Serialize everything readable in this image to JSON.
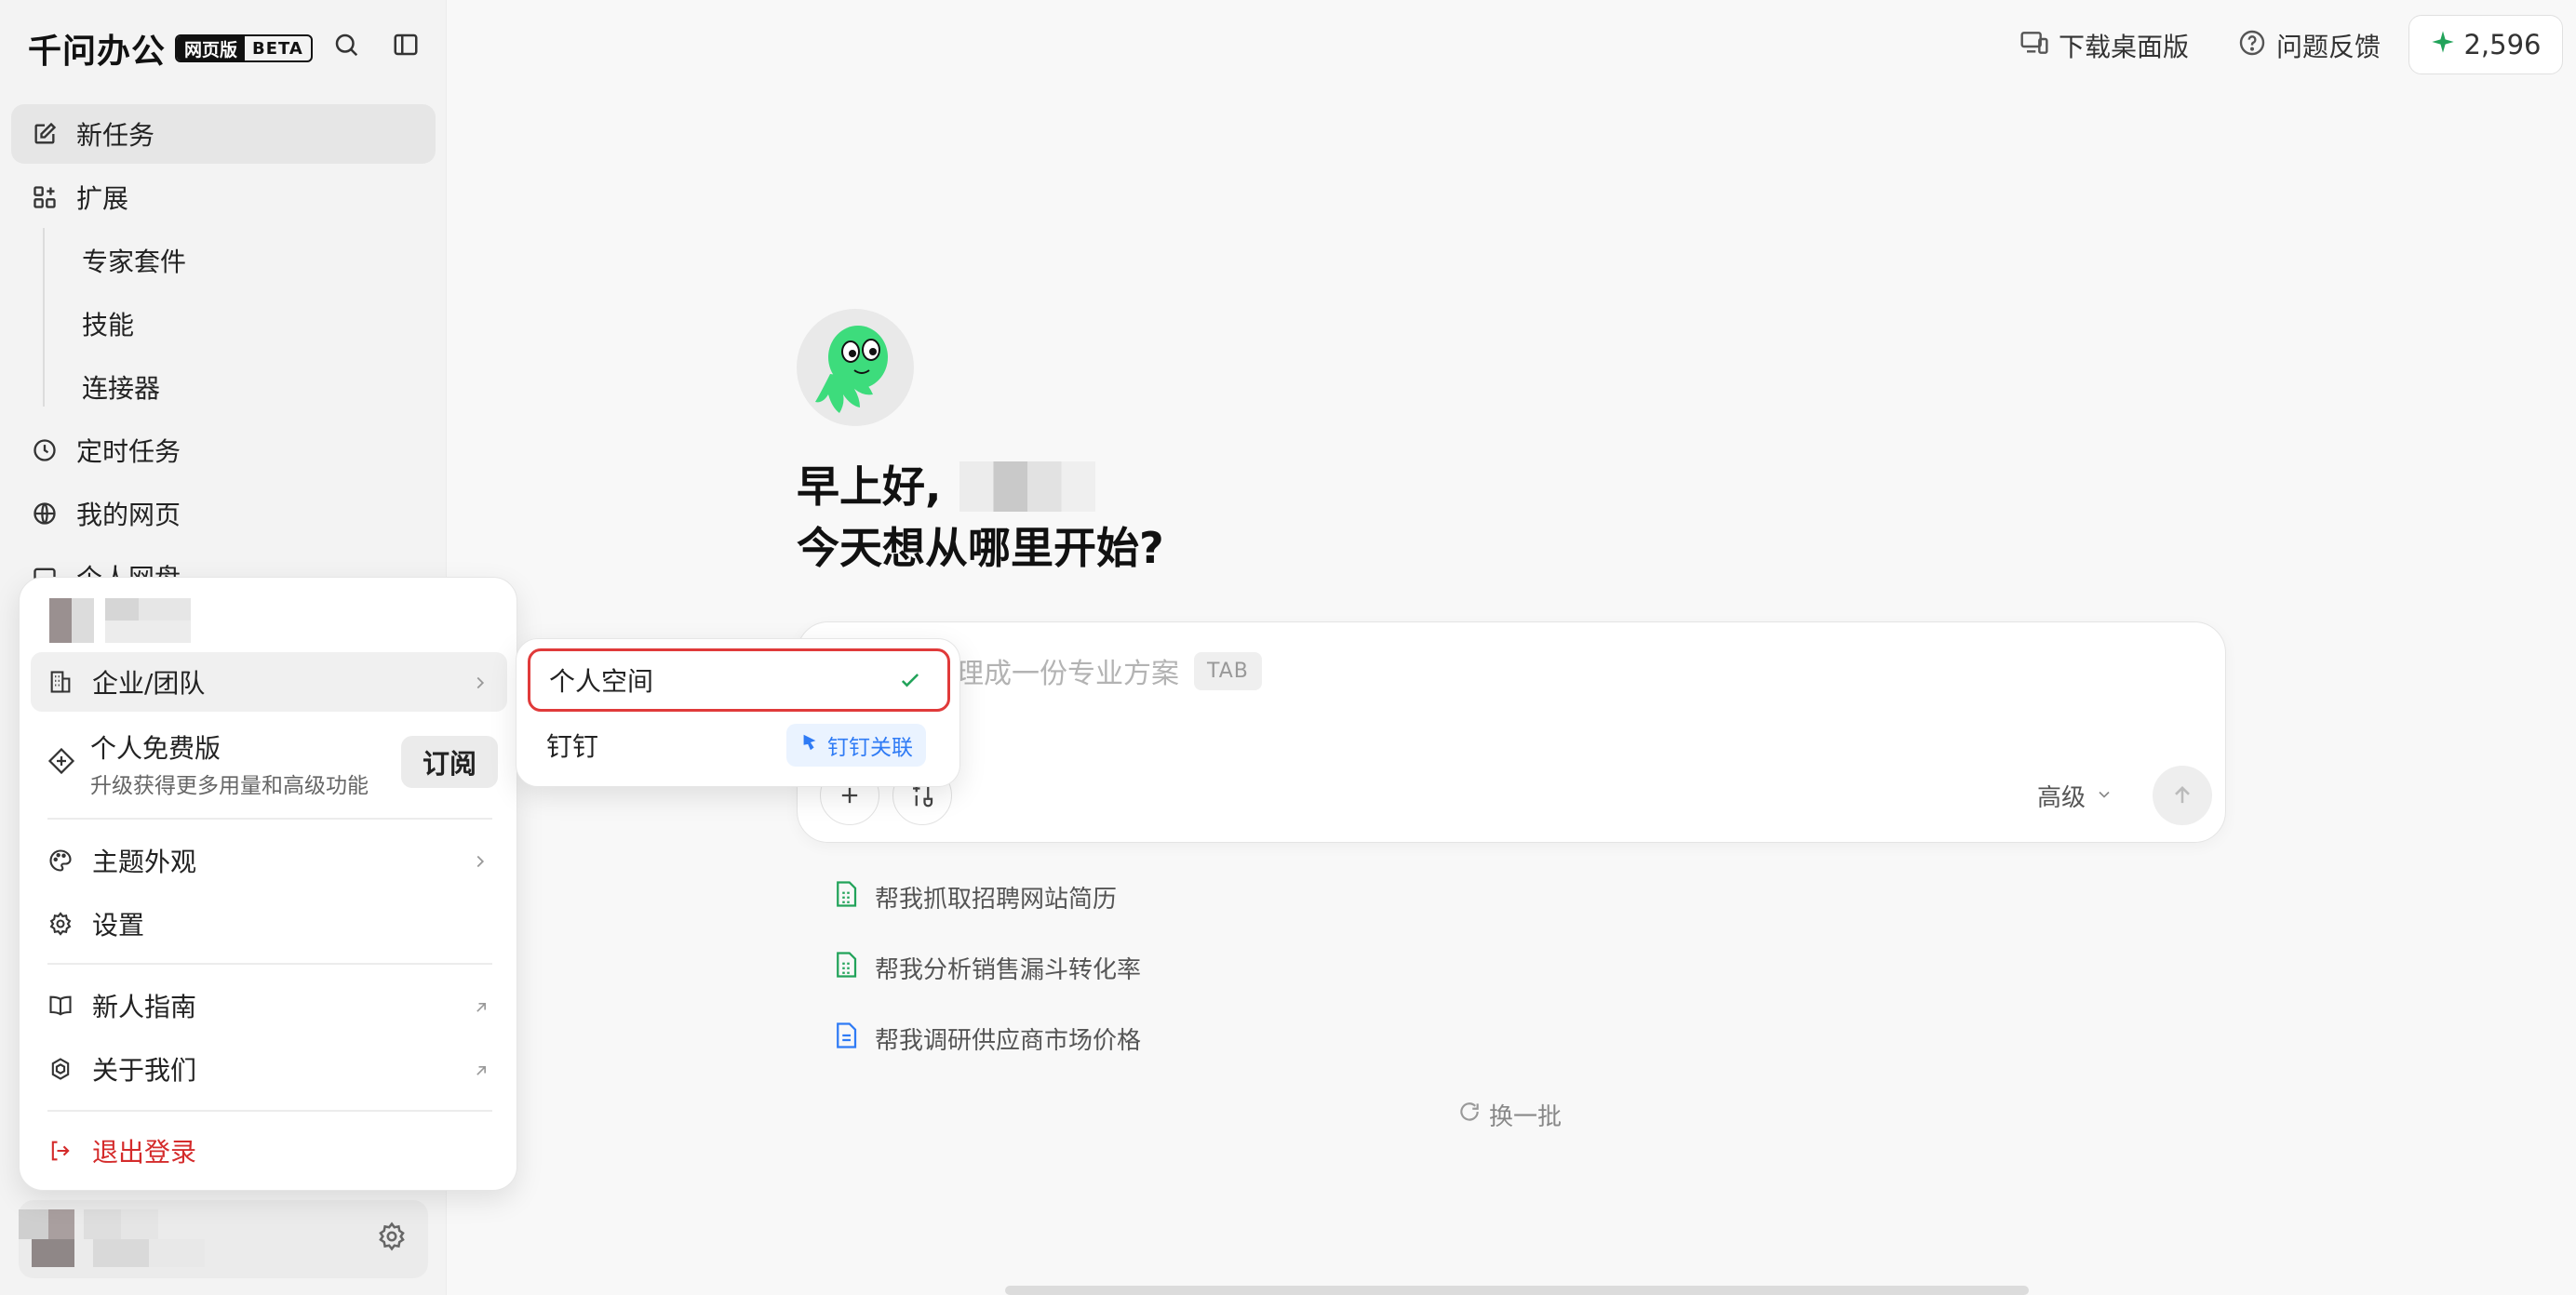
{
  "brand": {
    "name": "千问办公",
    "tag1": "网页版",
    "tag2": "BETA"
  },
  "sidebar": {
    "new_task": "新任务",
    "extensions": "扩展",
    "sub_items": [
      "专家套件",
      "技能",
      "连接器"
    ],
    "scheduled": "定时任务",
    "my_pages": "我的网页",
    "drive": "个人网盘"
  },
  "topbar": {
    "download": "下载桌面版",
    "feedback": "问题反馈",
    "credits": "2,596"
  },
  "colors": {
    "brand_green": "#22a35a",
    "alert_red": "#e03a3a",
    "link_blue": "#2f7bf5"
  },
  "main": {
    "greeting_line1": "早上好,",
    "greeting_line2": "今天想从哪里开始?",
    "placeholder": "理成一份专业方案",
    "tab_hint": "TAB",
    "advanced": "高级",
    "suggestions": [
      "帮我抓取招聘网站简历",
      "帮我分析销售漏斗转化率",
      "帮我调研供应商市场价格"
    ],
    "refresh": "换一批"
  },
  "menu": {
    "team": "企业/团队",
    "plan_title": "个人免费版",
    "plan_sub": "升级获得更多用量和高级功能",
    "subscribe": "订阅",
    "theme": "主题外观",
    "settings": "设置",
    "guide": "新人指南",
    "about": "关于我们",
    "logout": "退出登录"
  },
  "submenu": {
    "personal": "个人空间",
    "dingtalk": "钉钉",
    "dingtalk_link": "钉钉关联"
  }
}
